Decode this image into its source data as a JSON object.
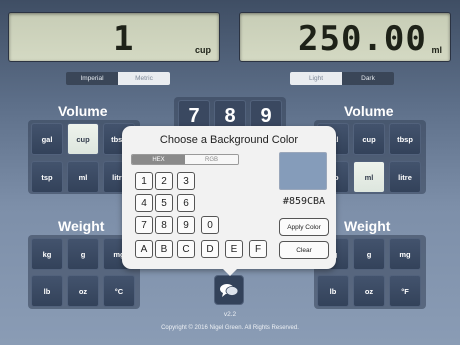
{
  "displays": {
    "left": {
      "value": "1",
      "unit": "cup"
    },
    "right": {
      "value": "250.00",
      "unit": "ml"
    }
  },
  "system_toggle": {
    "options": [
      "Imperial",
      "Metric"
    ],
    "selected": "Imperial"
  },
  "theme_toggle": {
    "options": [
      "Light",
      "Dark"
    ],
    "selected": "Dark"
  },
  "volume": {
    "title": "Volume",
    "left_units": [
      "gal",
      "cup",
      "tbsp",
      "tsp",
      "ml",
      "litre"
    ],
    "left_selected": "cup",
    "right_units": [
      "gal",
      "cup",
      "tbsp",
      "tsp",
      "ml",
      "litre"
    ],
    "right_selected": "ml"
  },
  "weight": {
    "title": "Weight",
    "left_units": [
      "kg",
      "g",
      "mg",
      "lb",
      "oz",
      "°C"
    ],
    "right_units": [
      "kg",
      "g",
      "mg",
      "lb",
      "oz",
      "°F"
    ]
  },
  "numpad_visible": [
    "7",
    "8",
    "9"
  ],
  "dialog": {
    "title": "Choose a Background Color",
    "modes": [
      "HEX",
      "RGB"
    ],
    "selected_mode": "HEX",
    "keys": [
      "1",
      "2",
      "3",
      "4",
      "5",
      "6",
      "7",
      "8",
      "9",
      "0",
      "A",
      "B",
      "C",
      "D",
      "E",
      "F"
    ],
    "swatch_color": "#859CBA",
    "hex_value": "#859CBA",
    "apply_label": "Apply Color",
    "clear_label": "Clear"
  },
  "footer": {
    "version": "v2.2",
    "copyright": "Copyright © 2016 Nigel Green. All Rights Reserved."
  },
  "colors": {
    "accent": "#859CBA",
    "selected_key": "#e6ede4"
  }
}
